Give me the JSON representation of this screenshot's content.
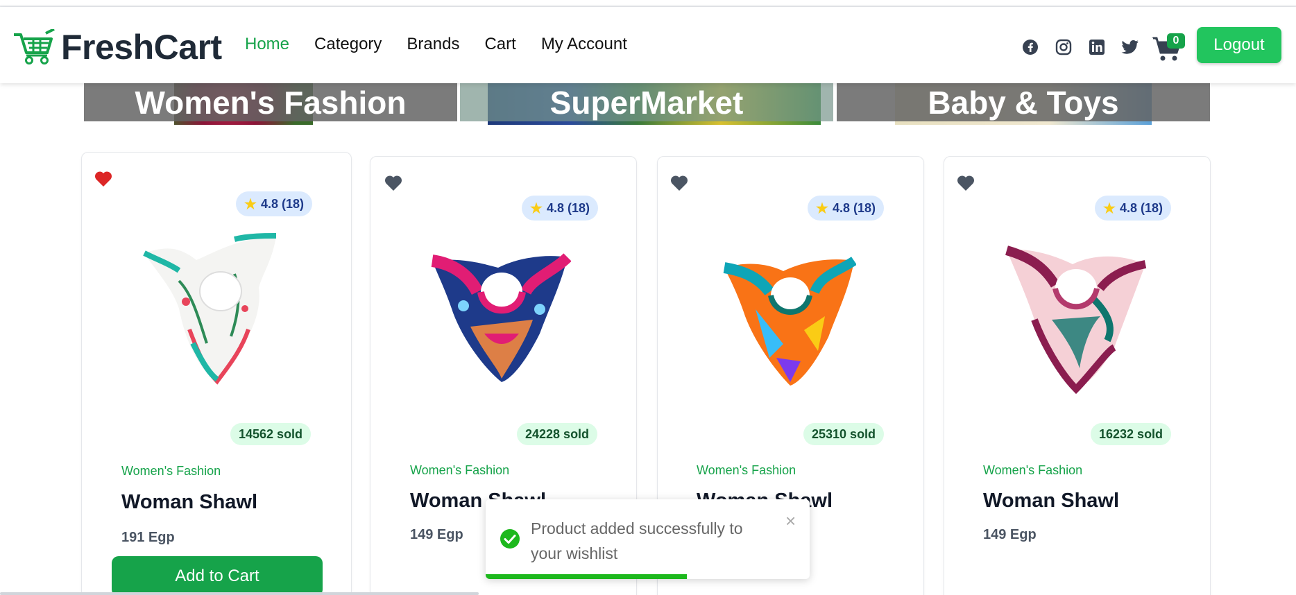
{
  "brand": {
    "name": "FreshCart",
    "color": "#16a34a"
  },
  "nav": {
    "items": [
      {
        "label": "Home",
        "active": true
      },
      {
        "label": "Category",
        "active": false
      },
      {
        "label": "Brands",
        "active": false
      },
      {
        "label": "Cart",
        "active": false
      },
      {
        "label": "My Account",
        "active": false
      }
    ],
    "socials": [
      "facebook-icon",
      "instagram-icon",
      "linkedin-icon",
      "twitter-icon"
    ],
    "cart_count": "0",
    "logout_label": "Logout"
  },
  "categories": [
    {
      "label": "Women's Fashion"
    },
    {
      "label": "SuperMarket"
    },
    {
      "label": "Baby & Toys"
    }
  ],
  "products": [
    {
      "rating": "4.8 (18)",
      "sold": "14562 sold",
      "category": "Women's Fashion",
      "title": "Woman Shawl",
      "price": "191 Egp",
      "wishlisted": true,
      "add_label": "Add to Cart"
    },
    {
      "rating": "4.8 (18)",
      "sold": "24228 sold",
      "category": "Women's Fashion",
      "title": "Woman Shawl",
      "price": "149 Egp",
      "wishlisted": false
    },
    {
      "rating": "4.8 (18)",
      "sold": "25310 sold",
      "category": "Women's Fashion",
      "title": "Woman Shawl",
      "price": "",
      "wishlisted": false
    },
    {
      "rating": "4.8 (18)",
      "sold": "16232 sold",
      "category": "Women's Fashion",
      "title": "Woman Shawl",
      "price": "149 Egp",
      "wishlisted": false
    }
  ],
  "toast": {
    "message": "Product added successfully to your wishlist",
    "close": "×",
    "progress": 0.62
  },
  "colors": {
    "accent": "#16a34a",
    "heart_active": "#dc2626",
    "heart_inactive": "#4b5563"
  }
}
